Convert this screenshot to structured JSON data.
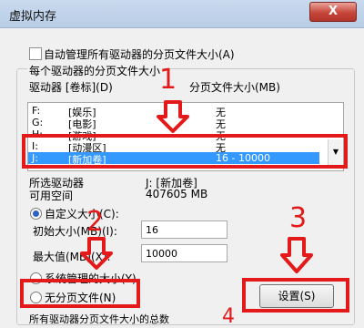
{
  "window": {
    "title": "虚拟内存",
    "close_label": "X"
  },
  "auto_manage": {
    "label": "自动管理所有驱动器的分页文件大小(A)",
    "checked": false
  },
  "section": {
    "title": "每个驱动器的分页文件大小"
  },
  "list": {
    "col_drive": "驱动器 [卷标](D)",
    "col_size": "分页文件大小(MB)",
    "rows": [
      {
        "drive": "F:",
        "label": "[娱乐]",
        "size": "无",
        "selected": false
      },
      {
        "drive": "G:",
        "label": "[电影]",
        "size": "无",
        "selected": false
      },
      {
        "drive": "H:",
        "label": "[游戏]",
        "size": "无",
        "selected": false
      },
      {
        "drive": "I:",
        "label": "[动漫区]",
        "size": "无",
        "selected": false
      },
      {
        "drive": "J:",
        "label": "[新加卷]",
        "size": "16 - 10000",
        "selected": true
      }
    ]
  },
  "selected_drive": {
    "label": "所选驱动器",
    "value": "J:  [新加卷]"
  },
  "free_space": {
    "label": "可用空间",
    "value": "407605 MB"
  },
  "custom_size": {
    "label": "自定义大小(C):",
    "initial_label": "初始大小(MB)(I):",
    "initial_value": "16",
    "max_label": "最大值(MB)(X):",
    "max_value": "10000"
  },
  "system_managed": {
    "label": "系统管理的大小(Y)"
  },
  "no_paging": {
    "label": "无分页文件(N)"
  },
  "set_button": {
    "label": "设置(S)"
  },
  "bottom_text": "所有驱动器分页文件大小的总数",
  "annotations": {
    "step1": "1",
    "step2": "2",
    "step3": "3",
    "step4": "4",
    "color": "#e41919"
  }
}
